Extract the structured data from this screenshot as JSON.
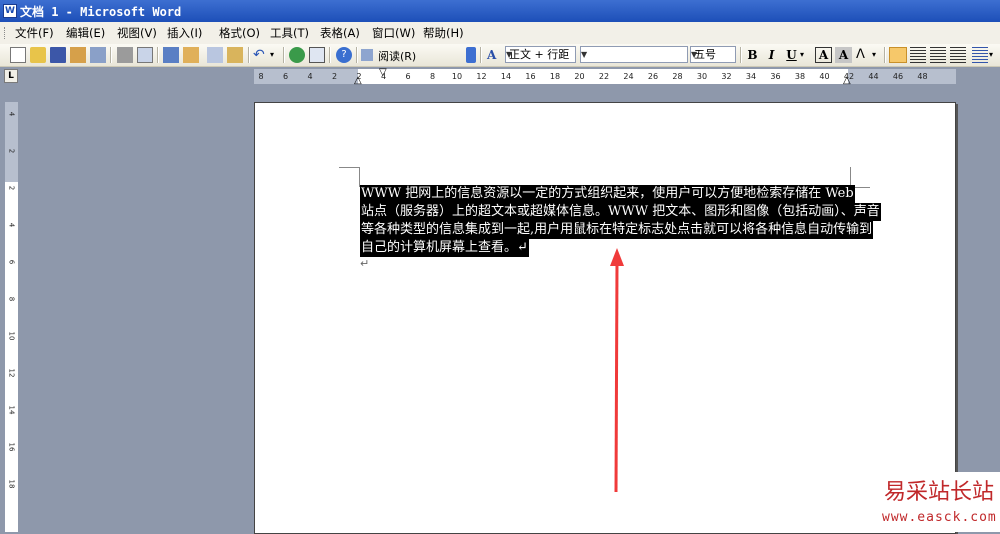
{
  "window": {
    "title": "文档 1 - Microsoft Word"
  },
  "menu": [
    "文件(F)",
    "编辑(E)",
    "视图(V)",
    "插入(I)",
    "格式(O)",
    "工具(T)",
    "表格(A)",
    "窗口(W)",
    "帮助(H)"
  ],
  "toolbar": {
    "reading_label": "阅读(R)",
    "style_value": "正文 + 行距",
    "font_value": "",
    "size_value": "五号",
    "bold": "B",
    "italic": "I",
    "underline": "U",
    "char_border": "A",
    "char_shading": "A"
  },
  "ruler": {
    "ticks": [
      "8",
      "6",
      "4",
      "2",
      "2",
      "4",
      "6",
      "8",
      "10",
      "12",
      "14",
      "16",
      "18",
      "20",
      "22",
      "24",
      "26",
      "28",
      "30",
      "32",
      "34",
      "36",
      "38",
      "40",
      "42",
      "44",
      "46",
      "48"
    ],
    "vticks": [
      "4",
      "2",
      "2",
      "4",
      "6",
      "8",
      "10",
      "12",
      "14",
      "16",
      "18"
    ]
  },
  "document": {
    "lines": [
      "    WWW 把网上的信息资源以一定的方式组织起来，使用户可以方便地检索存储在 Web",
      "站点（服务器）上的超文本或超媒体信息。WWW 把文本、图形和图像（包括动画）、声音",
      "等各种类型的信息集成到一起,用户用鼠标在特定标志处点击就可以将各种信息自动传输到",
      "自己的计算机屏幕上查看。↵"
    ],
    "empty_para_mark": "↵"
  },
  "annotation": {
    "color": "#f03a3a"
  },
  "watermark": {
    "site_name": "易采站长站",
    "url": "www.easck.com"
  }
}
